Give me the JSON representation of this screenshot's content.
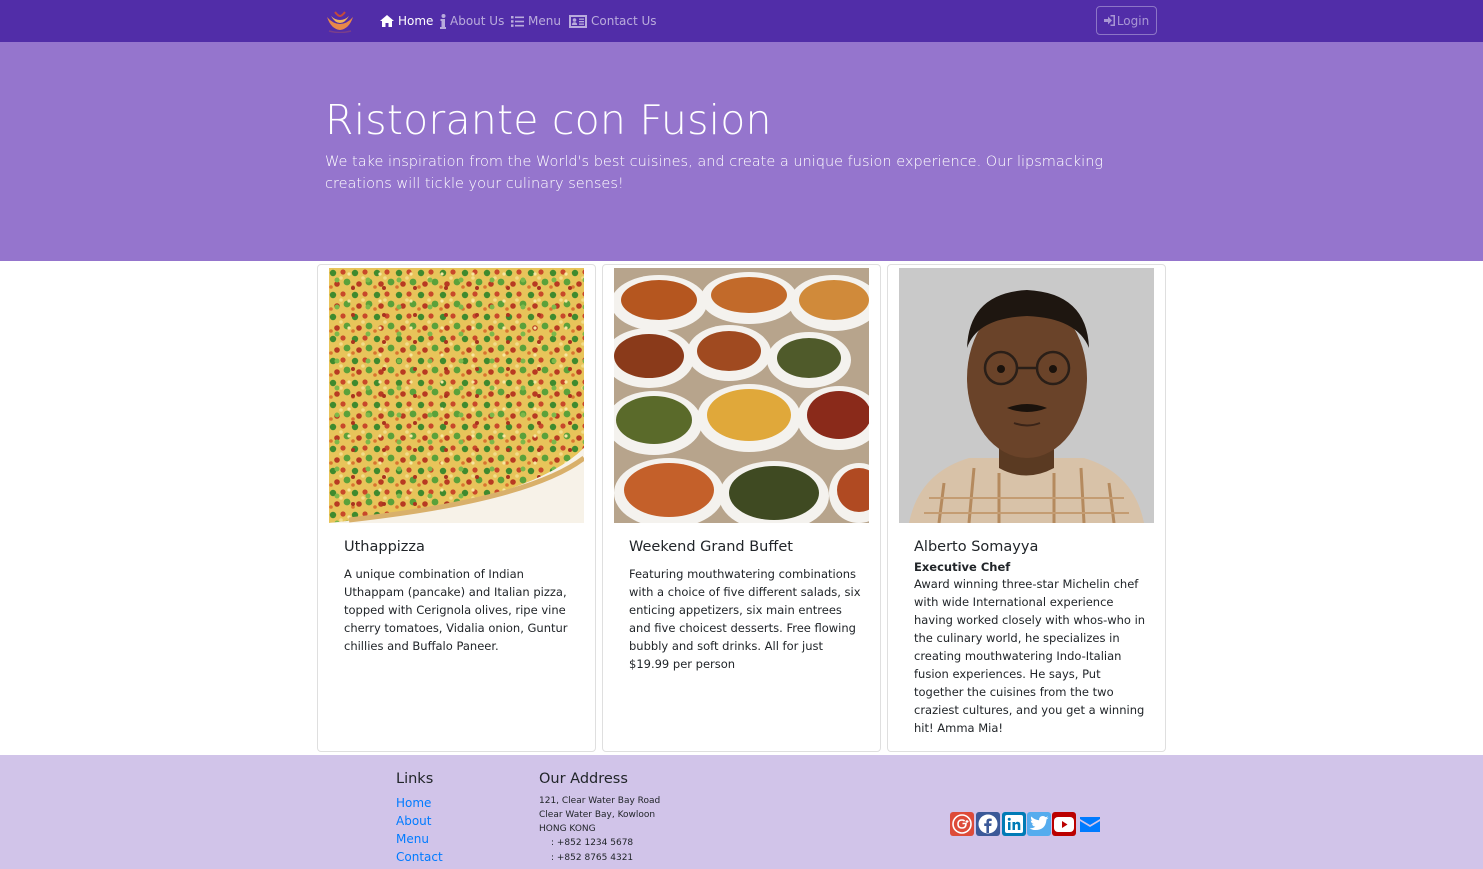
{
  "nav": {
    "brand_icon": "restaurant-logo",
    "items": [
      {
        "label": "Home",
        "icon": "home-icon",
        "active": true
      },
      {
        "label": "About Us",
        "icon": "info-icon",
        "active": false
      },
      {
        "label": "Menu",
        "icon": "list-icon",
        "active": false
      },
      {
        "label": "Contact Us",
        "icon": "address-card-icon",
        "active": false
      }
    ],
    "login_label": "Login",
    "login_icon": "sign-in-icon"
  },
  "jumbotron": {
    "title": "Ristorante con Fusion",
    "text": "We take inspiration from the World's best cuisines, and create a unique fusion experience. Our lipsmacking creations will tickle your culinary senses!"
  },
  "cards": [
    {
      "title": "Uthappizza",
      "subtitle": "",
      "text": "A unique combination of Indian Uthappam (pancake) and Italian pizza, topped with Cerignola olives, ripe vine cherry tomatoes, Vidalia onion, Guntur chillies and Buffalo Paneer."
    },
    {
      "title": "Weekend Grand Buffet",
      "subtitle": "",
      "text": "Featuring mouthwatering combinations with a choice of five different salads, six enticing appetizers, six main entrees and five choicest desserts. Free flowing bubbly and soft drinks. All for just $19.99 per person"
    },
    {
      "title": "Alberto Somayya",
      "subtitle": "Executive Chef",
      "text": "Award winning three-star Michelin chef with wide International experience having worked closely with whos-who in the culinary world, he specializes in creating mouthwatering Indo-Italian fusion experiences. He says, Put together the cuisines from the two craziest cultures, and you get a winning hit! Amma Mia!"
    }
  ],
  "footer": {
    "links_heading": "Links",
    "links": [
      "Home",
      "About",
      "Menu",
      "Contact"
    ],
    "address_heading": "Our Address",
    "address_lines": [
      "121, Clear Water Bay Road",
      "Clear Water Bay, Kowloon",
      "HONG KONG"
    ],
    "phone": ": +852 1234 5678",
    "fax": ": +852 8765 4321",
    "social": [
      {
        "icon": "google-plus-icon",
        "color": "#dd4b39"
      },
      {
        "icon": "facebook-icon",
        "color": "#3b5998"
      },
      {
        "icon": "linkedin-icon",
        "color": "#007bb6"
      },
      {
        "icon": "twitter-icon",
        "color": "#55acee"
      },
      {
        "icon": "youtube-icon",
        "color": "#bb0000"
      },
      {
        "icon": "mail-icon",
        "color": "#007bff"
      }
    ]
  },
  "colors": {
    "navbar": "#512DA8",
    "jumbotron": "#9575CD",
    "footer": "#D1C4E9",
    "link": "#007bff"
  }
}
